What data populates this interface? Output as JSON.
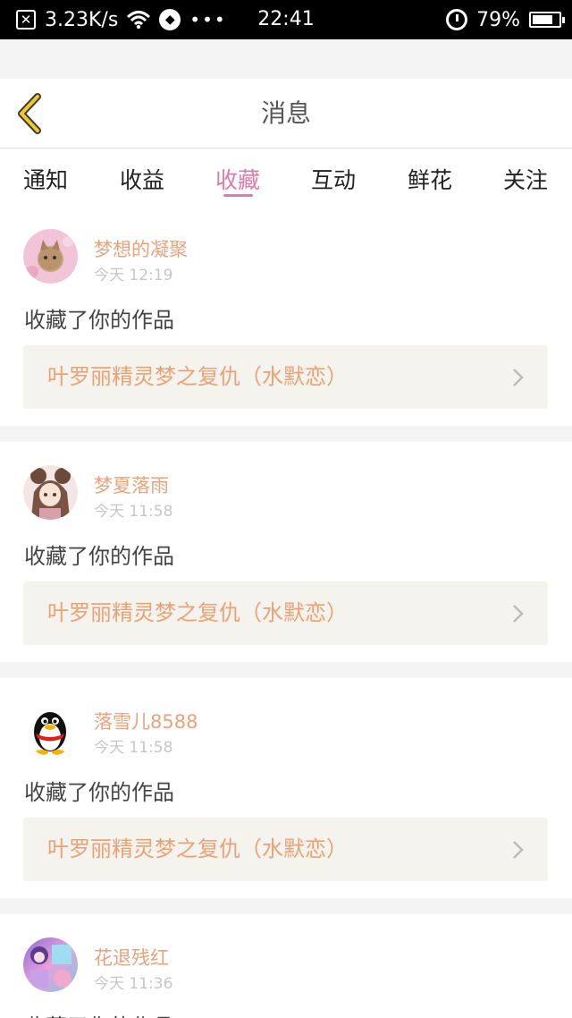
{
  "status_bar": {
    "speed": "3.23K/s",
    "dots": "•••",
    "time": "22:41",
    "battery": "79%",
    "battery_level": 0.79
  },
  "header": {
    "title": "消息"
  },
  "tabs": [
    {
      "label": "通知"
    },
    {
      "label": "收益"
    },
    {
      "label": "收藏",
      "active": true
    },
    {
      "label": "互动"
    },
    {
      "label": "鲜花"
    },
    {
      "label": "关注"
    }
  ],
  "items": [
    {
      "user": "梦想的凝聚",
      "time": "今天 12:19",
      "action": "收藏了你的作品",
      "work": "叶罗丽精灵梦之复仇（水默恋）"
    },
    {
      "user": "梦夏落雨",
      "time": "今天 11:58",
      "action": "收藏了你的作品",
      "work": "叶罗丽精灵梦之复仇（水默恋）"
    },
    {
      "user": "落雪儿8588",
      "time": "今天 11:58",
      "action": "收藏了你的作品",
      "work": "叶罗丽精灵梦之复仇（水默恋）"
    },
    {
      "user": "花退残红",
      "time": "今天 11:36",
      "action": "收藏了你的作品"
    }
  ],
  "colors": {
    "accent": "#e07aa8",
    "name": "#e8a37c",
    "work": "#eaa274",
    "back": "#f0c828"
  }
}
